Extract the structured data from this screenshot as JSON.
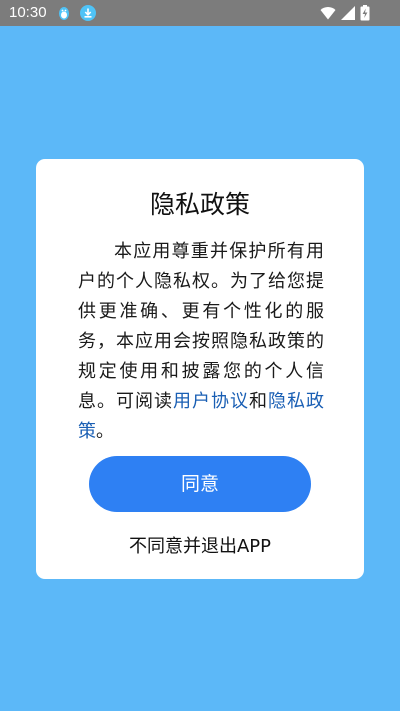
{
  "status_bar": {
    "time": "10:30",
    "icons": [
      "qq-penguin-icon",
      "download-icon",
      "wifi-icon",
      "signal-icon",
      "battery-charging-icon"
    ]
  },
  "dialog": {
    "title": "隐私政策",
    "body_text": "本应用尊重并保护所有用户的个人隐私权。为了给您提供更准确、更有个性化的服务，本应用会按照隐私政策的规定使用和披露您的个人信息。可阅读",
    "user_agreement_link": "用户协议",
    "conjunction": "和",
    "privacy_policy_link": "隐私政策",
    "end_punct": "。",
    "agree_label": "同意",
    "disagree_label": "不同意并退出APP"
  },
  "colors": {
    "background": "#5cb8f8",
    "status_bar": "#7c7c7c",
    "button": "#2e80f3",
    "link": "#1a5fb4"
  }
}
